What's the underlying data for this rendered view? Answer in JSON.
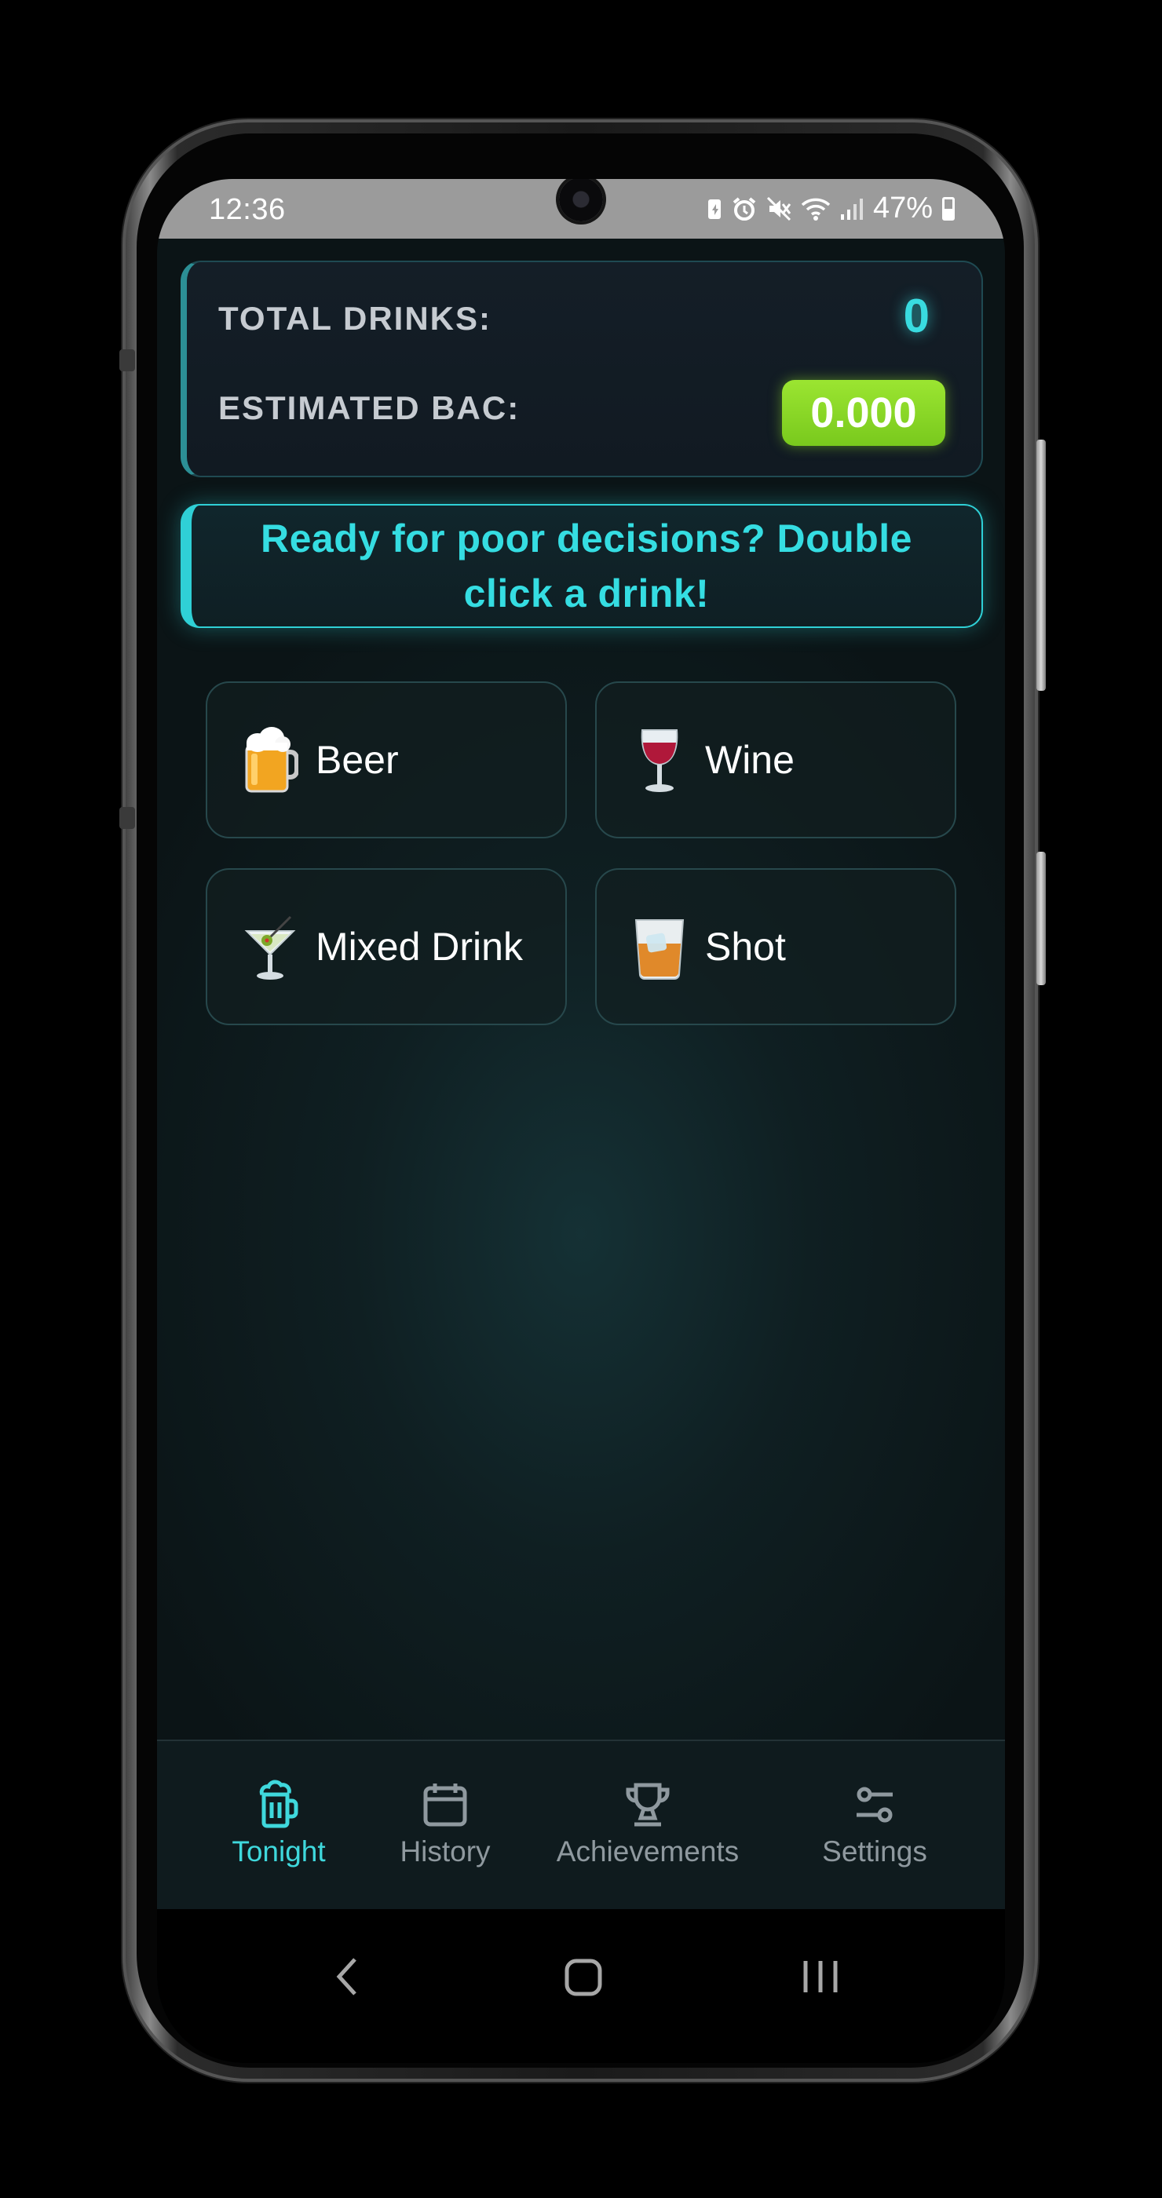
{
  "status_bar": {
    "time": "12:36",
    "battery": "47%",
    "icons": [
      "saver-icon",
      "alarm-icon",
      "mute-icon",
      "wifi-icon",
      "signal-icon",
      "battery-icon"
    ]
  },
  "stats": {
    "total_label": "TOTAL DRINKS:",
    "total_value": "0",
    "bac_label": "ESTIMATED BAC:",
    "bac_value": "0.000"
  },
  "banner": {
    "text": "Ready for poor decisions? Double click a drink!"
  },
  "drinks": [
    {
      "label": "Beer",
      "icon": "beer-mug-icon"
    },
    {
      "label": "Wine",
      "icon": "wine-glass-icon"
    },
    {
      "label": "Mixed Drink",
      "icon": "cocktail-glass-icon"
    },
    {
      "label": "Shot",
      "icon": "tumbler-glass-icon"
    }
  ],
  "nav": {
    "items": [
      {
        "label": "Tonight",
        "icon": "beer-mug-icon",
        "active": true
      },
      {
        "label": "History",
        "icon": "calendar-icon",
        "active": false
      },
      {
        "label": "Achievements",
        "icon": "trophy-icon",
        "active": false
      },
      {
        "label": "Settings",
        "icon": "sliders-icon",
        "active": false
      }
    ]
  },
  "colors": {
    "accent": "#39dbe0",
    "bac_badge": "#8ed628",
    "background": "#0f1f22"
  }
}
